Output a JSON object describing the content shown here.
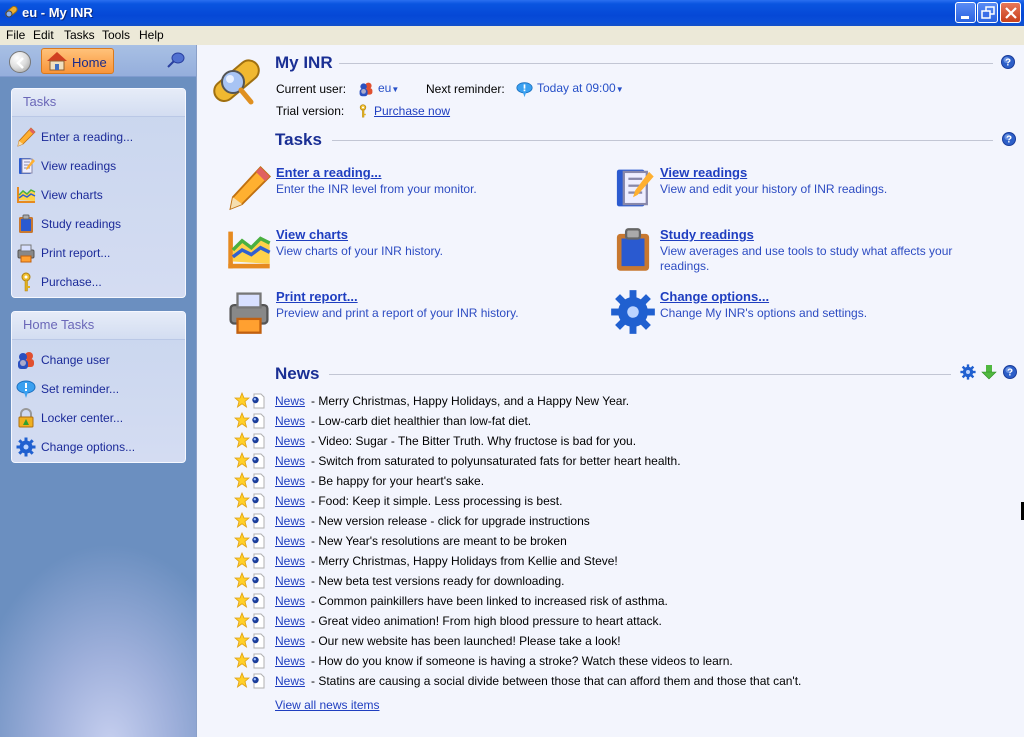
{
  "window": {
    "title": "eu - My INR",
    "controls": [
      "minimize",
      "restore",
      "close"
    ]
  },
  "menu": [
    "File",
    "Edit",
    "Tasks",
    "Tools",
    "Help"
  ],
  "sidebar": {
    "home_label": "Home",
    "tasks_panel": {
      "title": "Tasks",
      "items": [
        {
          "label": "Enter a reading...",
          "icon": "pencil-icon"
        },
        {
          "label": "View readings",
          "icon": "book-icon"
        },
        {
          "label": "View charts",
          "icon": "chart-icon"
        },
        {
          "label": "Study readings",
          "icon": "clipboard-icon"
        },
        {
          "label": "Print report...",
          "icon": "printer-icon"
        },
        {
          "label": "Purchase...",
          "icon": "key-icon"
        }
      ]
    },
    "home_tasks_panel": {
      "title": "Home Tasks",
      "items": [
        {
          "label": "Change user",
          "icon": "users-icon"
        },
        {
          "label": "Set reminder...",
          "icon": "speech-bubble-icon"
        },
        {
          "label": "Locker center...",
          "icon": "lock-icon"
        },
        {
          "label": "Change options...",
          "icon": "gear-icon"
        }
      ]
    }
  },
  "header": {
    "title": "My INR",
    "current_user_label": "Current user:",
    "current_user": "eu",
    "next_reminder_label": "Next reminder:",
    "next_reminder": "Today at 09:00",
    "trial_label": "Trial version:",
    "purchase_link": "Purchase now"
  },
  "tasks": {
    "title": "Tasks",
    "items": [
      {
        "title": "Enter a reading...",
        "desc": "Enter the INR level from your monitor.",
        "icon": "pencil-icon"
      },
      {
        "title": "View readings",
        "desc": "View and edit your history of INR readings.",
        "icon": "book-icon"
      },
      {
        "title": "View charts",
        "desc": "View charts of your INR history.",
        "icon": "chart-icon"
      },
      {
        "title": "Study readings",
        "desc": "View averages and use tools to study what affects your readings.",
        "icon": "clipboard-icon"
      },
      {
        "title": "Print report...",
        "desc": "Preview and print a report of your INR history.",
        "icon": "printer-icon"
      },
      {
        "title": "Change options...",
        "desc": "Change My INR's options and settings.",
        "icon": "gear-icon"
      }
    ]
  },
  "news": {
    "title": "News",
    "link_label": "News",
    "items": [
      "- Merry Christmas, Happy Holidays, and a Happy New Year.",
      "- Low-carb diet healthier than low-fat diet.",
      "- Video: Sugar - The Bitter Truth. Why fructose is bad for you.",
      "- Switch from saturated to polyunsaturated fats for better heart health.",
      "- Be happy for your heart's sake.",
      "- Food: Keep it simple. Less processing is best.",
      "- New version release - click for upgrade instructions",
      "- New Year's resolutions are meant to be broken",
      "- Merry Christmas, Happy Holidays from Kellie and Steve!",
      "- New beta test versions ready for downloading.",
      "- Common painkillers have been linked to increased risk of asthma.",
      "- Great video animation! From high blood pressure to heart attack.",
      "- Our new website has been launched! Please take a look!",
      "- How do you know if someone is having a stroke? Watch these videos to learn.",
      "- Statins are causing a social divide between those that can afford them and those that can't."
    ],
    "view_all": "View all news items"
  }
}
